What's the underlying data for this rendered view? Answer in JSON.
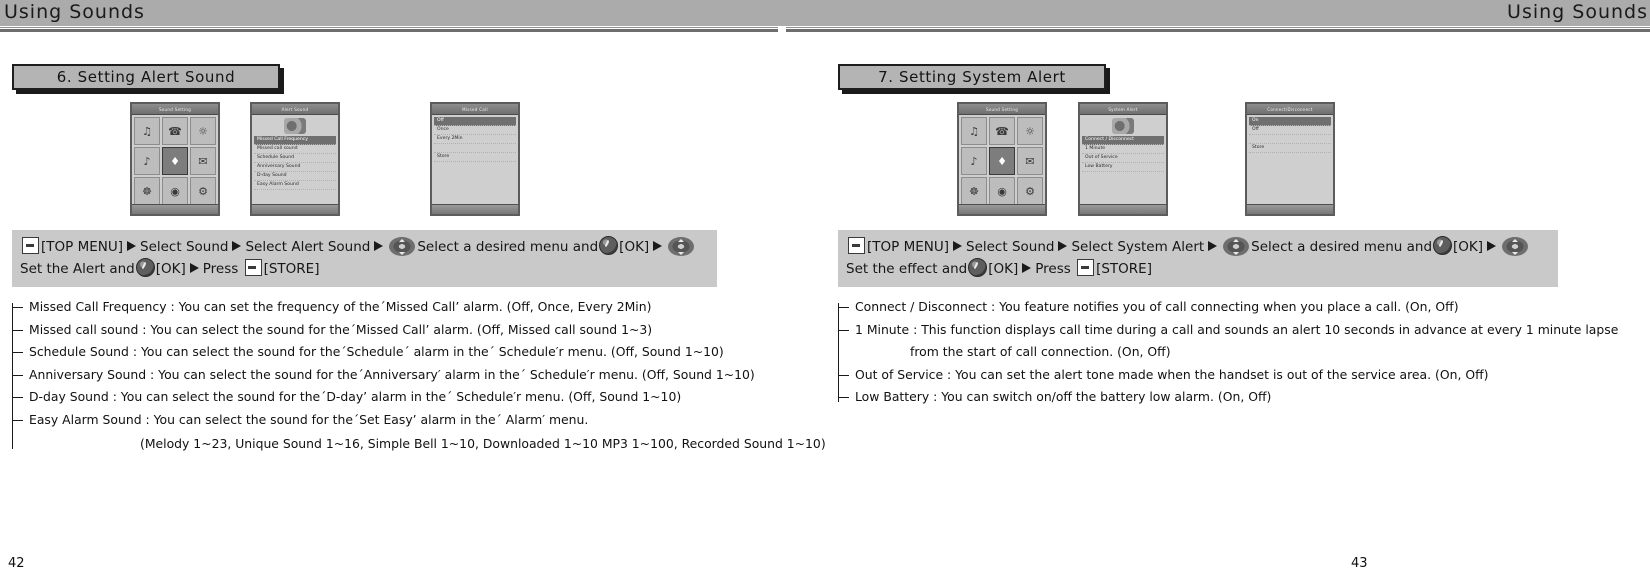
{
  "header": {
    "left_title": "Using Sounds",
    "right_title": "Using Sounds"
  },
  "left_page": {
    "page_number": "42",
    "section_title": "6. Setting Alert Sound",
    "phones": [
      {
        "name": "sound-menu-grid",
        "lcd_title": "Sound Setting",
        "type": "grid"
      },
      {
        "name": "alert-sound-list",
        "lcd_title": "Alert Sound",
        "type": "list-speaker",
        "items": [
          "Missed Call Frequency",
          "Missed call sound",
          "Schedule Sound",
          "Anniversary Sound",
          "D-day Sound",
          "Easy Alarm Sound"
        ]
      },
      {
        "name": "alert-sound-detail",
        "lcd_title": "Missed Call",
        "type": "list",
        "items": [
          "Off",
          "Once",
          "Every 2Min",
          "",
          "Store"
        ]
      }
    ],
    "steps": {
      "softkey_icon": "softkey-icon",
      "ok_icon": "ok-key-icon",
      "nav_icon": "navigation-key-icon",
      "arrow_icon": "right-arrow-icon",
      "top_menu": "[TOP MENU]",
      "step_1": "Select Sound",
      "step_2": "Select Alert Sound",
      "step_3": "Select a desired menu and",
      "ok_label": "[OK]",
      "step_4": "Set the Alert and",
      "ok_label_2": "[OK]",
      "press_label": "Press",
      "store_label": "[STORE]"
    },
    "bullets": [
      "Missed Call Frequency : You can set the frequency of the´Missed Call’ alarm. (Off, Once, Every 2Min)",
      "Missed call sound : You can select the sound for the´Missed Call’ alarm. (Off, Missed call sound 1~3)",
      "Schedule Sound : You can select the sound for the´Schedule´ alarm in the´ Schedule′r menu. (Off, Sound 1~10)",
      "Anniversary Sound : You can select the sound for the´Anniversary′ alarm in the´ Schedule′r menu. (Off, Sound 1~10)",
      "D-day Sound : You can select the sound for the´D-day’ alarm in the´ Schedule′r menu. (Off, Sound 1~10)",
      "Easy Alarm Sound : You can select the sound for the´Set Easy’ alarm in the´ Alarm′ menu."
    ],
    "bullet_note": "(Melody 1~23, Unique Sound 1~16, Simple Bell 1~10, Downloaded 1~10 MP3 1~100, Recorded Sound 1~10)"
  },
  "right_page": {
    "page_number": "43",
    "section_title": "7. Setting System Alert",
    "phones": [
      {
        "name": "sound-menu-grid",
        "lcd_title": "Sound Setting",
        "type": "grid"
      },
      {
        "name": "system-alert-list",
        "lcd_title": "System Alert",
        "type": "list-speaker",
        "items": [
          "Connect / Disconnect",
          "1 Minute",
          "Out of Service",
          "Low Battery"
        ]
      },
      {
        "name": "system-alert-detail",
        "lcd_title": "Connect/Disconnect",
        "type": "list",
        "items": [
          "On",
          "Off",
          "",
          "Store"
        ]
      }
    ],
    "steps": {
      "softkey_icon": "softkey-icon",
      "ok_icon": "ok-key-icon",
      "nav_icon": "navigation-key-icon",
      "arrow_icon": "right-arrow-icon",
      "top_menu": "[TOP MENU]",
      "step_1": "Select Sound",
      "step_2": "Select System Alert",
      "step_3": "Select a desired menu and",
      "ok_label": "[OK]",
      "step_4": "Set the effect and",
      "ok_label_2": "[OK]",
      "press_label": "Press",
      "store_label": "[STORE]"
    },
    "bullets": [
      "Connect / Disconnect : You feature notifies you of call connecting when you place a call. (On, Off)",
      "1 Minute : This function displays call time during a call and sounds an alert 10 seconds in advance at every 1 minute lapse",
      "Out of Service : You can set the alert tone made when the handset is out of the service area. (On, Off)",
      "Low Battery : You can switch on/off the battery low alarm. (On, Off)"
    ],
    "bullet_continuation": "from the start of call connection. (On, Off)"
  }
}
